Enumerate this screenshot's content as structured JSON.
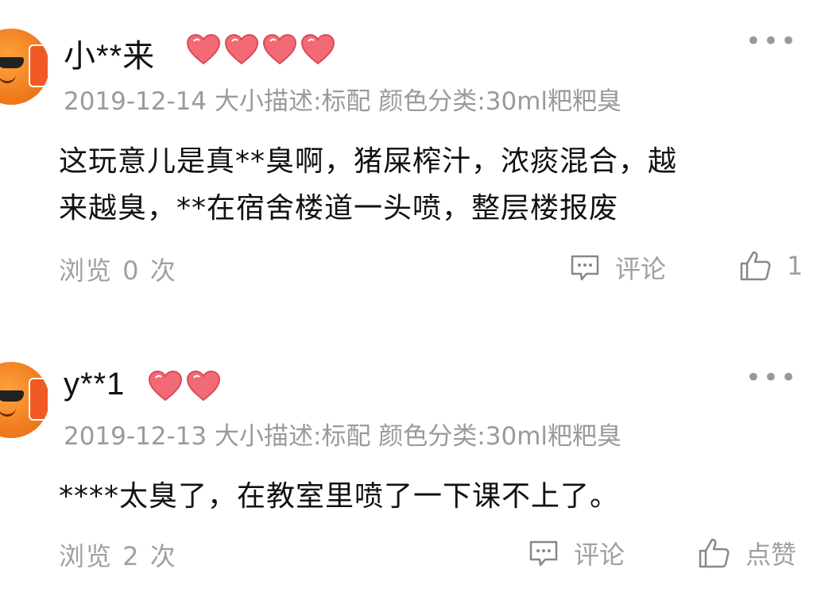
{
  "reviews": [
    {
      "username": "小**来",
      "heart_count": 4,
      "meta": "2019-12-14 大小描述:标配 颜色分类:30ml粑粑臭",
      "content_line1": "这玩意儿是真**臭啊，猪屎榨汁，浓痰混合，越",
      "content_line2": "来越臭，**在宿舍楼道一头喷，整层楼报废",
      "views": "浏览 0 次",
      "comment_label": "评论",
      "like_label": "1"
    },
    {
      "username": "y**1",
      "heart_count": 2,
      "meta": "2019-12-13 大小描述:标配 颜色分类:30ml粑粑臭",
      "content_line1": "****太臭了，在教室里喷了一下课不上了。",
      "views": "浏览 2 次",
      "comment_label": "评论",
      "like_label": "点赞"
    }
  ],
  "icons": {
    "more": "more-dots-icon",
    "comment": "comment-bubble-icon",
    "like": "thumbs-up-icon",
    "heart": "heart-rank-icon"
  },
  "colors": {
    "heart_fill": "#f26b74",
    "avatar": "#f07c1f",
    "meta_text": "#9a9a9a"
  }
}
